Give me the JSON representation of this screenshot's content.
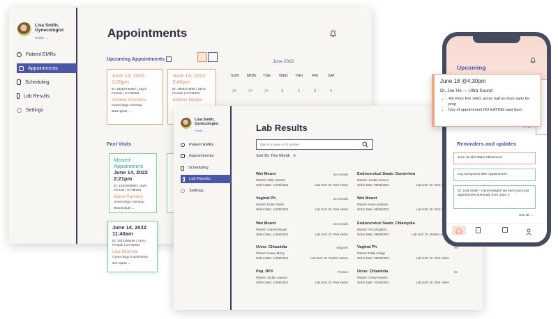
{
  "user": {
    "name_line1": "Lisa Smith,",
    "name_line2": "Gynecologist",
    "profile_link": "Profile →"
  },
  "nav": {
    "patient_emrs": "Patient EMRs",
    "appointments": "Appointments",
    "scheduling": "Scheduling",
    "lab_results": "Lab Results",
    "settings": "Settings"
  },
  "appointments": {
    "title": "Appointments",
    "upcoming_heading": "Upcoming Appointments",
    "upcoming": [
      {
        "date": "June 14, 2022",
        "time": "3:20pm",
        "id": "ID: 19283746457 | 23y/o",
        "sex": "Female | GYN8483",
        "patient": "Andrea Simmons",
        "type": "Gynecology Checkup",
        "link": "start report →"
      },
      {
        "date": "June 14, 2022",
        "time": "3:40pm",
        "id": "ID: 1928374566 | 34y/o",
        "sex": "Female | GYN8483",
        "patient": "Simone Berger",
        "type": "",
        "link": ""
      }
    ],
    "calendar": {
      "month": "June 2022",
      "days": [
        "SUN",
        "MON",
        "TUE",
        "WED",
        "THU",
        "FRI",
        "SAT"
      ],
      "dates": [
        "28",
        "29",
        "30",
        "1",
        "2",
        "3",
        "4"
      ]
    },
    "past_heading": "Past Visits",
    "past": [
      {
        "status": "Missed Appointment",
        "date": "June 14, 2022",
        "time": "2:21pm",
        "id": "ID: 1933456588 | 18y/o",
        "sex": "Female | GYN8483",
        "patient": "Blake Ramsey",
        "type": "Gynecology Checkup",
        "link": "Reschedule →"
      },
      {
        "status": "",
        "date": "June 14, 2022",
        "time": "11:40am",
        "id": "ID: 2013356489 | 21y/o",
        "sex": "Female | GYN8483",
        "patient": "Lisa Mcbride",
        "type": "Gynecology Examination",
        "link": "see report →"
      }
    ]
  },
  "lab_results": {
    "title": "Lab Results",
    "search_placeholder": "Type in a name or ID number",
    "sort_label": "Sort By This Month",
    "left_column": [
      {
        "title": "Wet Mount",
        "right": "See Details",
        "patient": "Patient: Sally Stenton",
        "date": "Order Date: 14/06/2022",
        "tech": "Lab tech: Dr. Rick Helen"
      },
      {
        "title": "Vaginal Ph",
        "right": "See Details",
        "patient": "Patient: Helen Smith",
        "date": "Order Date: 14/06/2022",
        "tech": "Lab tech: Dr. Rick Helen"
      },
      {
        "title": "Wet Mount",
        "right": "See Details",
        "patient": "Patient: Joanne Brown",
        "date": "Order Date: 14/06/2022",
        "tech": "Lab tech: Dr. Rick Helen"
      },
      {
        "title": "Urine: Chlamidia",
        "right": "Negative",
        "patient": "Patient: Casey Morry",
        "date": "Order Date: 14/06/2022",
        "tech": "Lab tech: Dr. Rachel James"
      },
      {
        "title": "Pap, HPV",
        "right": "Positive",
        "patient": "Patient: Jackie Lawson",
        "date": "Order Date: 14/06/2022",
        "tech": "Lab tech: Dr. Rick Helen"
      }
    ],
    "right_column": [
      {
        "title": "Endocervical Swab: Gonorrhea",
        "right": "Ne",
        "patient": "Patient: Jordan Alvarez",
        "date": "Order Date: 08/06/2022",
        "tech": "Lab tech: Dr. Rick Helen"
      },
      {
        "title": "Wet Mount",
        "right": "Se",
        "patient": "Patient: Karen Sullivan",
        "date": "Order Date: 08/06/2022",
        "tech": "Lab tech: Dr. Rick Helen"
      },
      {
        "title": "Endocervical Swab: Chlamydia",
        "right": "Po",
        "patient": "Patient: Ari Livingston",
        "date": "Order Date: 08/06/2022",
        "tech": "Lab tech: Dr. Rachel James"
      },
      {
        "title": "Vaginal Ph",
        "right": "Se",
        "patient": "Patient: Patty Hodge",
        "date": "Order Date: 08/06/2022",
        "tech": "Lab tech: Dr. Rick Helen"
      },
      {
        "title": "Urine: Chlamidia",
        "right": "Ne",
        "patient": "Patient: Cheryl Haines",
        "date": "Order Date: 01/06/2022",
        "tech": "Lab tech: Dr. Rick Helen"
      }
    ]
  },
  "phone": {
    "upcoming_heading": "Upcoming",
    "popup": {
      "title": "June 18 @4:30pm",
      "doctor": "Dr. Joe Ho — Ultra Sound",
      "bullet1": "4th Floor Rm 1420, arrive half an hour early for prep",
      "bullet2": "Day of appointment NO EATING past 8am"
    },
    "see_all_1": "ee all →",
    "reminders_heading": "Reminders and updates",
    "reminders": [
      "June 18 @4:30pm Ultrasound",
      "Log Symptoms after Appointment",
      "Dr. Lisa Smith - Gynecologist has sent your post appointment summary from June 3"
    ],
    "see_all_2": "See all →"
  },
  "colors": {
    "accent": "#4a56a6",
    "coral": "#f0a585",
    "green": "#7fcf9b",
    "dark": "#2b2f45"
  }
}
